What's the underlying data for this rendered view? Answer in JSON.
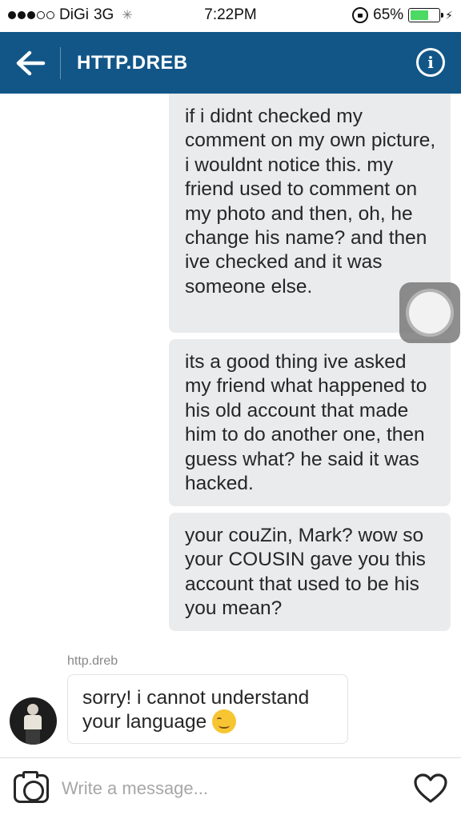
{
  "status_bar": {
    "carrier": "DiGi",
    "network": "3G",
    "time": "7:22PM",
    "battery_percent": "65%",
    "battery_level": 0.65,
    "signal_bars_filled": 3,
    "signal_bars_total": 5
  },
  "header": {
    "title": "HTTP.DREB",
    "accent_color": "#125688"
  },
  "messages_outgoing": [
    "if i didnt checked my comment on my own picture, i wouldnt notice this. my friend used to comment on my photo and then, oh, he change his name? and then ive checked and it was someone else.",
    "its a good thing ive asked my friend what happened to his old account that made him to do another one, then guess what? he said it was hacked.",
    "your couZin, Mark? wow so your COUSIN gave you this account that used to be his you mean?"
  ],
  "incoming": {
    "sender": "http.dreb",
    "text": "sorry! i cannot understand your language",
    "emoji": "smiling-face-icon"
  },
  "composer": {
    "placeholder": "Write a message..."
  },
  "icons": {
    "back": "arrow-left-icon",
    "info": "info-icon",
    "camera": "camera-icon",
    "heart": "heart-icon",
    "assistive": "assistive-touch-icon"
  }
}
